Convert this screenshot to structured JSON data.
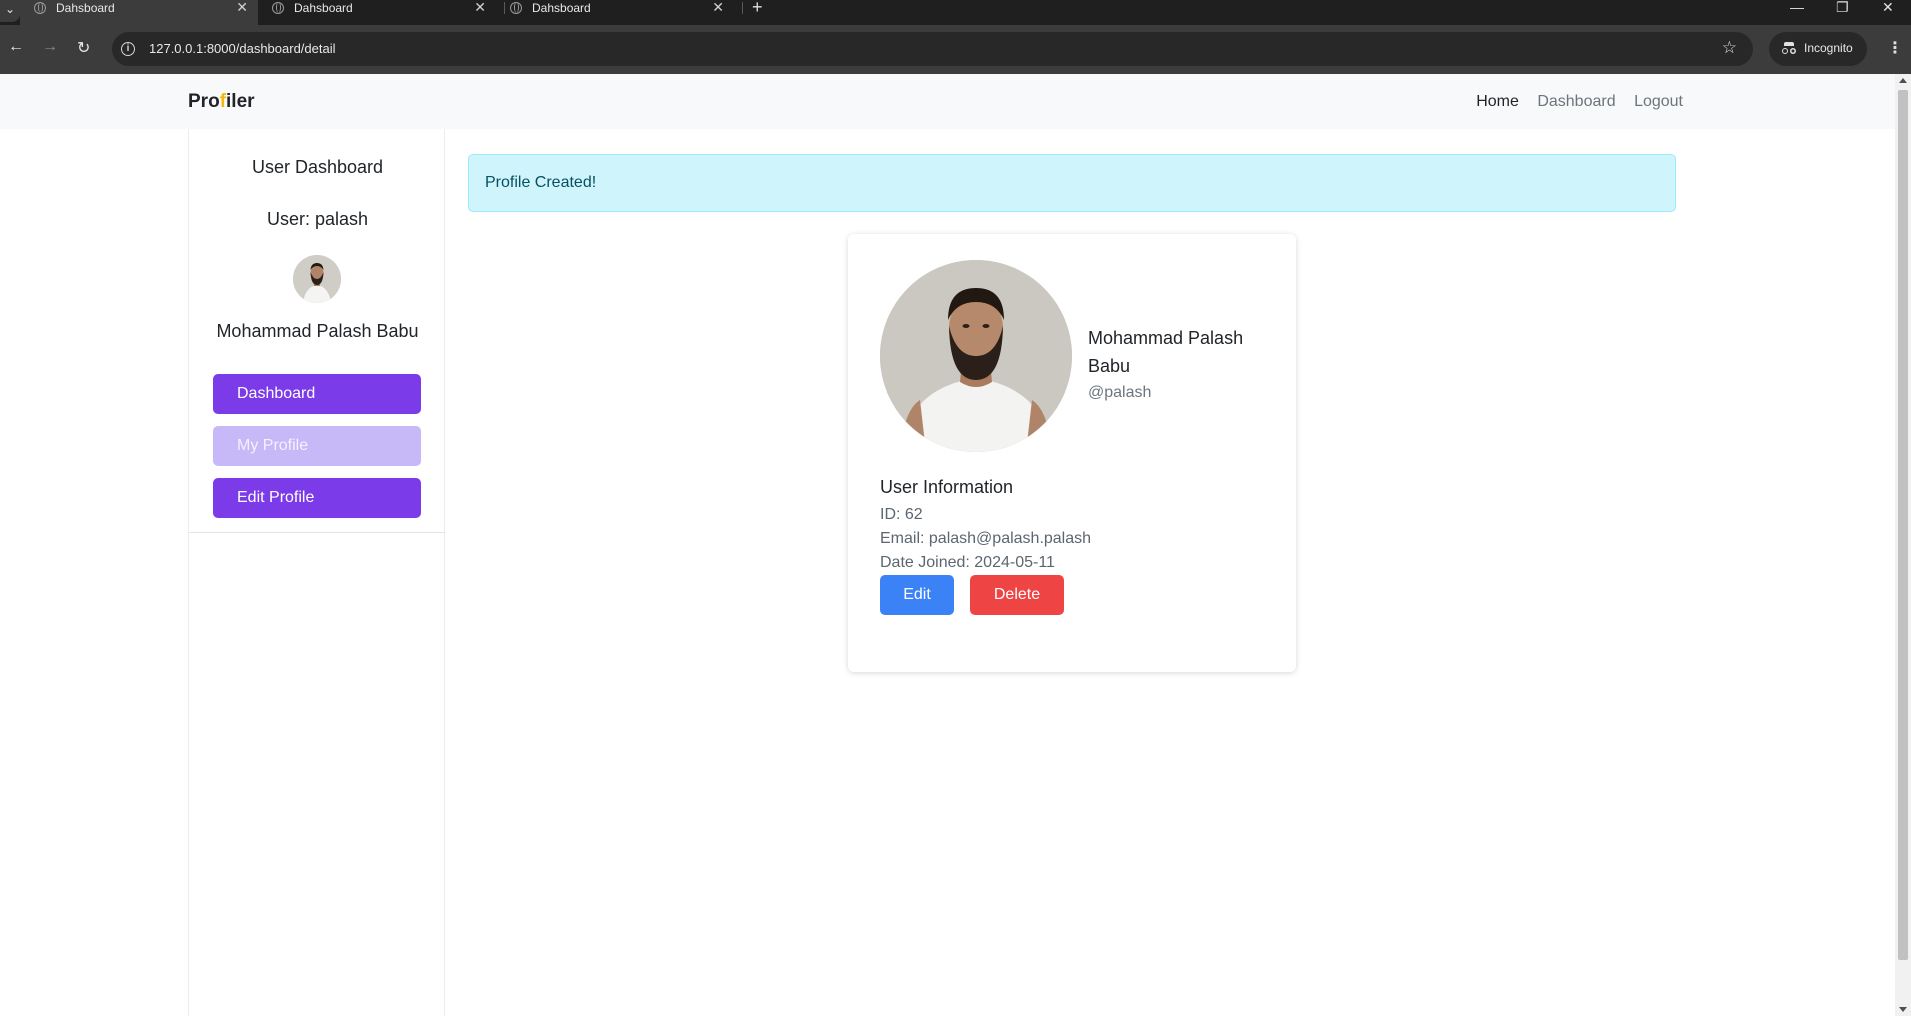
{
  "browser": {
    "tabs": [
      {
        "title": "Dahsboard",
        "active": true
      },
      {
        "title": "Dahsboard",
        "active": false
      },
      {
        "title": "Dahsboard",
        "active": false
      }
    ],
    "url": "127.0.0.1:8000/dashboard/detail",
    "incognito_label": "Incognito"
  },
  "navbar": {
    "brand_start": "Pro",
    "brand_accent": "f",
    "brand_end": "iler",
    "accent_color": "#f5b70a",
    "links": {
      "home": "Home",
      "dashboard": "Dashboard",
      "logout": "Logout"
    }
  },
  "sidebar": {
    "title": "User Dashboard",
    "user_line": "User: palash",
    "full_name": "Mohammad Palash Babu",
    "buttons": {
      "dashboard": "Dashboard",
      "my_profile": "My Profile",
      "edit_profile": "Edit Profile"
    },
    "primary_color": "#7b3be8"
  },
  "alert": {
    "message": "Profile Created!"
  },
  "profile": {
    "name": "Mohammad Palash Babu",
    "handle": "@palash",
    "info_title": "User Information",
    "id_line": "ID: 62",
    "email_line": "Email: palash@palash.palash",
    "joined_line": "Date Joined: 2024-05-11",
    "edit_label": "Edit",
    "delete_label": "Delete",
    "edit_color": "#3b82f6",
    "delete_color": "#ef4444"
  }
}
